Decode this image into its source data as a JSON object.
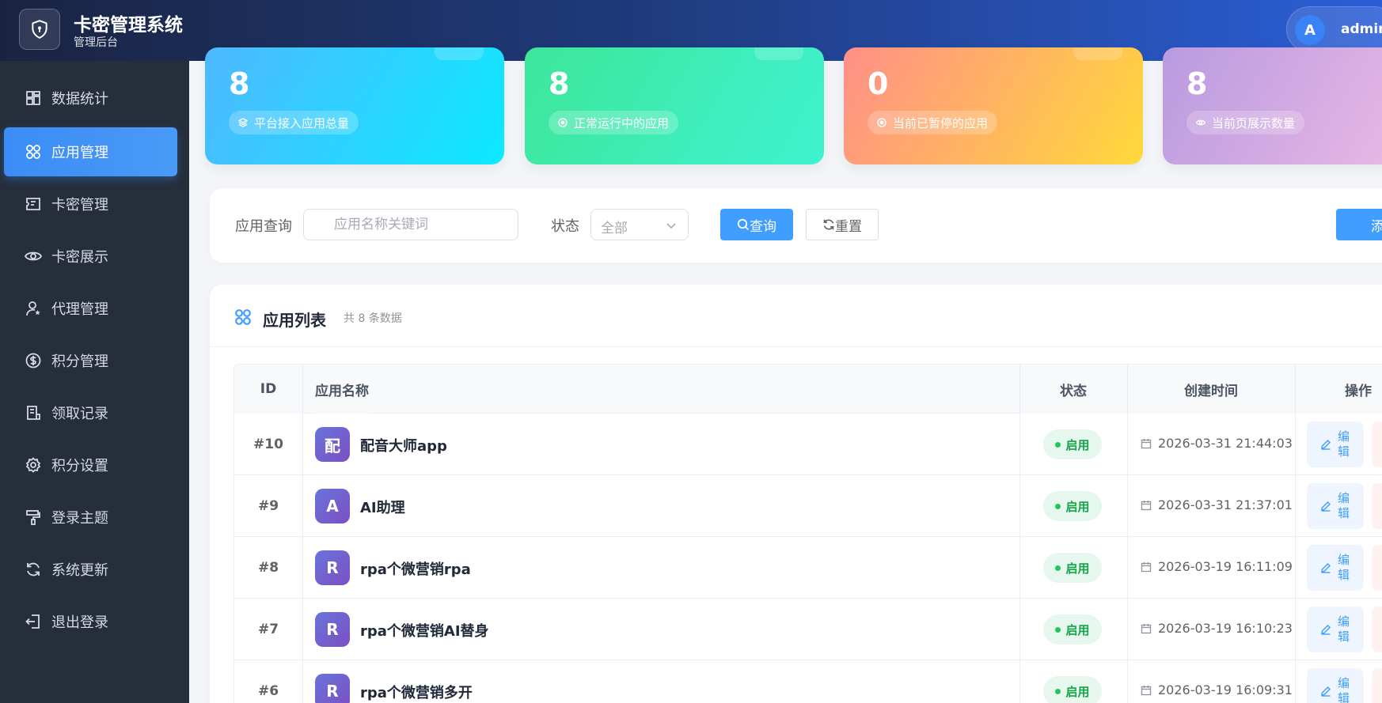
{
  "header": {
    "title": "卡密管理系统",
    "subtitle": "管理后台",
    "avatar_letter": "A",
    "username": "admin"
  },
  "sidebar": {
    "items": [
      {
        "label": "数据统计",
        "icon": "dashboard-icon",
        "active": false
      },
      {
        "label": "应用管理",
        "icon": "apps-icon",
        "active": true
      },
      {
        "label": "卡密管理",
        "icon": "ticket-icon",
        "active": false
      },
      {
        "label": "卡密展示",
        "icon": "eye-icon",
        "active": false
      },
      {
        "label": "代理管理",
        "icon": "user-star-icon",
        "active": false
      },
      {
        "label": "积分管理",
        "icon": "coin-icon",
        "active": false
      },
      {
        "label": "领取记录",
        "icon": "document-icon",
        "active": false
      },
      {
        "label": "积分设置",
        "icon": "gear-icon",
        "active": false
      },
      {
        "label": "登录主题",
        "icon": "paint-roller-icon",
        "active": false
      },
      {
        "label": "系统更新",
        "icon": "refresh-icon",
        "active": false
      },
      {
        "label": "退出登录",
        "icon": "logout-icon",
        "active": false
      }
    ]
  },
  "stats": [
    {
      "value": "8",
      "caption": "平台接入应用总量",
      "icon": "layers-icon",
      "color_from": "#4fb8ff",
      "color_to": "#0ceaff"
    },
    {
      "value": "8",
      "caption": "正常运行中的应用",
      "icon": "target-icon",
      "color_from": "#3ee69a",
      "color_to": "#3ef3d0"
    },
    {
      "value": "0",
      "caption": "当前已暂停的应用",
      "icon": "target-icon",
      "color_from": "#ff8f88",
      "color_to": "#ffd93a"
    },
    {
      "value": "8",
      "caption": "当前页展示数量",
      "icon": "eye-icon",
      "color_from": "#b99ae0",
      "color_to": "#e8b8e4"
    }
  ],
  "search": {
    "label": "应用查询",
    "placeholder": "应用名称关键词",
    "status_label": "状态",
    "status_value": "全部",
    "query_label": "查询",
    "reset_label": "重置",
    "add_label": "添"
  },
  "list": {
    "title": "应用列表",
    "count_text": "共 8 条数据",
    "columns": {
      "id": "ID",
      "name": "应用名称",
      "status": "状态",
      "created": "创建时间",
      "actions": "操作"
    },
    "edit_label": "编辑",
    "rows": [
      {
        "id": "#10",
        "icon_char": "配",
        "name": "配音大师app",
        "status": "启用",
        "created": "2026-03-31 21:44:03"
      },
      {
        "id": "#9",
        "icon_char": "A",
        "name": "AI助理",
        "status": "启用",
        "created": "2026-03-31 21:37:01"
      },
      {
        "id": "#8",
        "icon_char": "R",
        "name": "rpa个微营销rpa",
        "status": "启用",
        "created": "2026-03-19 16:11:09"
      },
      {
        "id": "#7",
        "icon_char": "R",
        "name": "rpa个微营销AI替身",
        "status": "启用",
        "created": "2026-03-19 16:10:23"
      },
      {
        "id": "#6",
        "icon_char": "R",
        "name": "rpa个微营销多开",
        "status": "启用",
        "created": "2026-03-19 16:09:31"
      }
    ]
  }
}
